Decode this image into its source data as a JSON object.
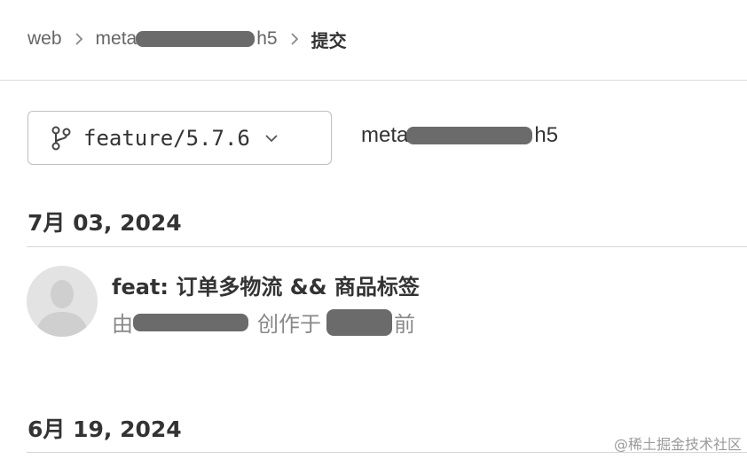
{
  "breadcrumb": {
    "items": [
      "web",
      "meta-",
      "提交"
    ],
    "repo_suffix": "h5"
  },
  "branch": {
    "name": "feature/5.7.6"
  },
  "repo": {
    "prefix": "meta-",
    "suffix": "h5"
  },
  "groups": [
    {
      "date": "7月 03, 2024",
      "commits": [
        {
          "title": "feat: 订单多物流 && 商品标签",
          "by": "由",
          "created": "创作于",
          "ago": "前"
        }
      ]
    },
    {
      "date": "6月 19, 2024"
    }
  ],
  "watermark": "@稀土掘金技术社区"
}
